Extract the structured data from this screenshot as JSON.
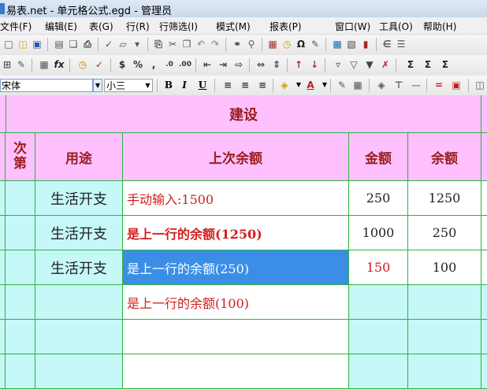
{
  "window": {
    "title": "易表.net - 单元格公式.egd - 管理员"
  },
  "menu": [
    "文件(F)",
    "编辑(E)",
    "表(G)",
    "行(R)",
    "行筛选(I)",
    "模式(M)",
    "报表(P)",
    "窗口(W)",
    "工具(O)",
    "帮助(H)"
  ],
  "format_toolbar": {
    "font_name": "宋体",
    "font_size": "小三",
    "bold_label": "B",
    "italic_label": "I",
    "underline_label": "U",
    "font_color_label": "A"
  },
  "toolbar_icons": {
    "row1": [
      "new-icon",
      "open-icon",
      "save-icon",
      "page-icon",
      "copy-page-icon",
      "print-icon",
      "check-icon",
      "export-icon",
      "filter-icon",
      "paste-icon",
      "cut-icon",
      "copy-icon",
      "undo-icon",
      "redo-icon",
      "find-icon",
      "zoom-icon",
      "calc-icon",
      "clock-icon",
      "omega-icon",
      "tools-icon",
      "table-icon",
      "record-icon",
      "chart-icon",
      "attach-icon",
      "properties-icon"
    ],
    "row2": [
      "insert-row-icon",
      "edit-row-icon",
      "grid-icon",
      "function-icon",
      "timer-icon",
      "confirm-icon",
      "currency-icon",
      "percent-icon",
      "comma-icon",
      "increase-decimal-icon",
      "decrease-decimal-icon",
      "indent-left-icon",
      "indent-right-icon",
      "expand-icon",
      "merge-icon",
      "split-icon",
      "sort-asc-icon",
      "sort-desc-icon",
      "filter-table-icon",
      "filter-yes-icon",
      "filter-col-icon",
      "filter-clear-icon",
      "sum-icon",
      "sum-row-icon",
      "sum-col-icon"
    ]
  },
  "sheet": {
    "group_header": "建设",
    "columns": {
      "seq": "次第",
      "purpose": "用途",
      "prev_balance": "上次余额",
      "amount": "金额",
      "balance": "余额"
    },
    "rows": [
      {
        "purpose": "生活开支",
        "prev_balance": "手动输入:1500",
        "amount": "250",
        "balance": "1250"
      },
      {
        "purpose": "生活开支",
        "prev_balance": "是上一行的余额(1250)",
        "amount": "1000",
        "balance": "250"
      },
      {
        "purpose": "生活开支",
        "prev_balance": "是上一行的余额(250)",
        "amount": "150",
        "balance": "100"
      },
      {
        "purpose": "",
        "prev_balance": "是上一行的余额(100)",
        "amount": "",
        "balance": ""
      },
      {
        "purpose": "",
        "prev_balance": "",
        "amount": "",
        "balance": ""
      },
      {
        "purpose": "",
        "prev_balance": "",
        "amount": "",
        "balance": ""
      }
    ]
  },
  "colors": {
    "header_bg": "#ffc0ff",
    "header_text": "#9a1c1c",
    "row_label_bg": "#c6f8f8",
    "grid_line": "#2fb23f",
    "selection": "#3a8ee6",
    "formula_text": "#d11e1e"
  }
}
